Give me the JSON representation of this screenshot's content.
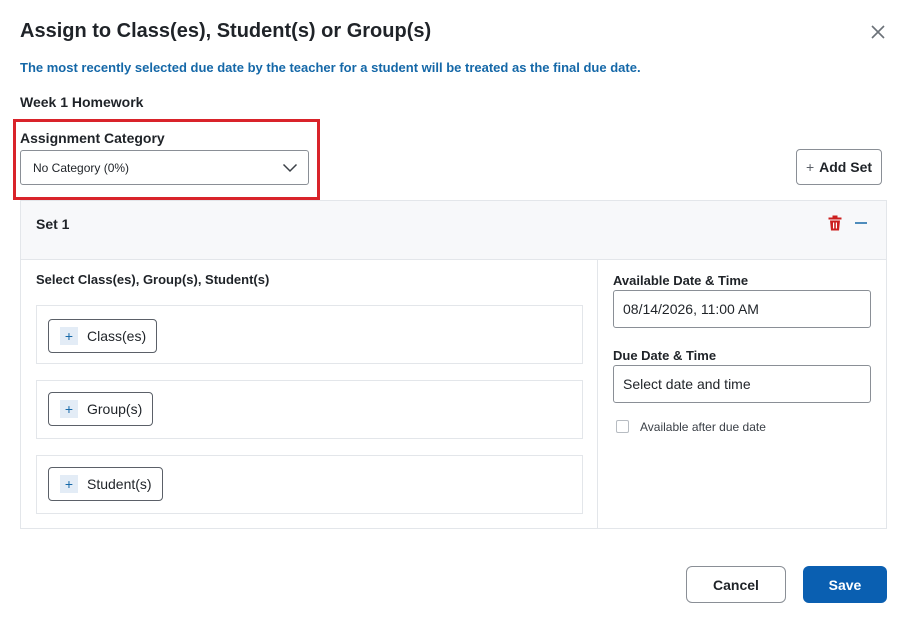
{
  "dialog": {
    "title": "Assign to Class(es), Student(s) or Group(s)",
    "notice": "The most recently selected due date by the teacher for a student will be treated as the final due date.",
    "assignment_name": "Week 1 Homework"
  },
  "category": {
    "label": "Assignment Category",
    "selected": "No Category (0%)"
  },
  "add_set_label": "Add Set",
  "set": {
    "title": "Set 1",
    "select_label": "Select Class(es), Group(s), Student(s)",
    "targets": [
      {
        "label": "Class(es)"
      },
      {
        "label": "Group(s)"
      },
      {
        "label": "Student(s)"
      }
    ],
    "available": {
      "label": "Available Date & Time",
      "value": "08/14/2026, 11:00 AM"
    },
    "due": {
      "label": "Due Date & Time",
      "value": "Select date and time"
    },
    "available_after_due_label": "Available after due date"
  },
  "buttons": {
    "cancel": "Cancel",
    "save": "Save"
  },
  "colors": {
    "accent": "#0a5fb1",
    "notice": "#1568a8",
    "highlight": "#d9232a",
    "delete": "#cc1f1f"
  },
  "icons": {
    "close": "close-icon",
    "dropdown": "chevron-down-icon",
    "delete": "trash-icon",
    "collapse": "minus-icon",
    "add": "plus-icon"
  }
}
